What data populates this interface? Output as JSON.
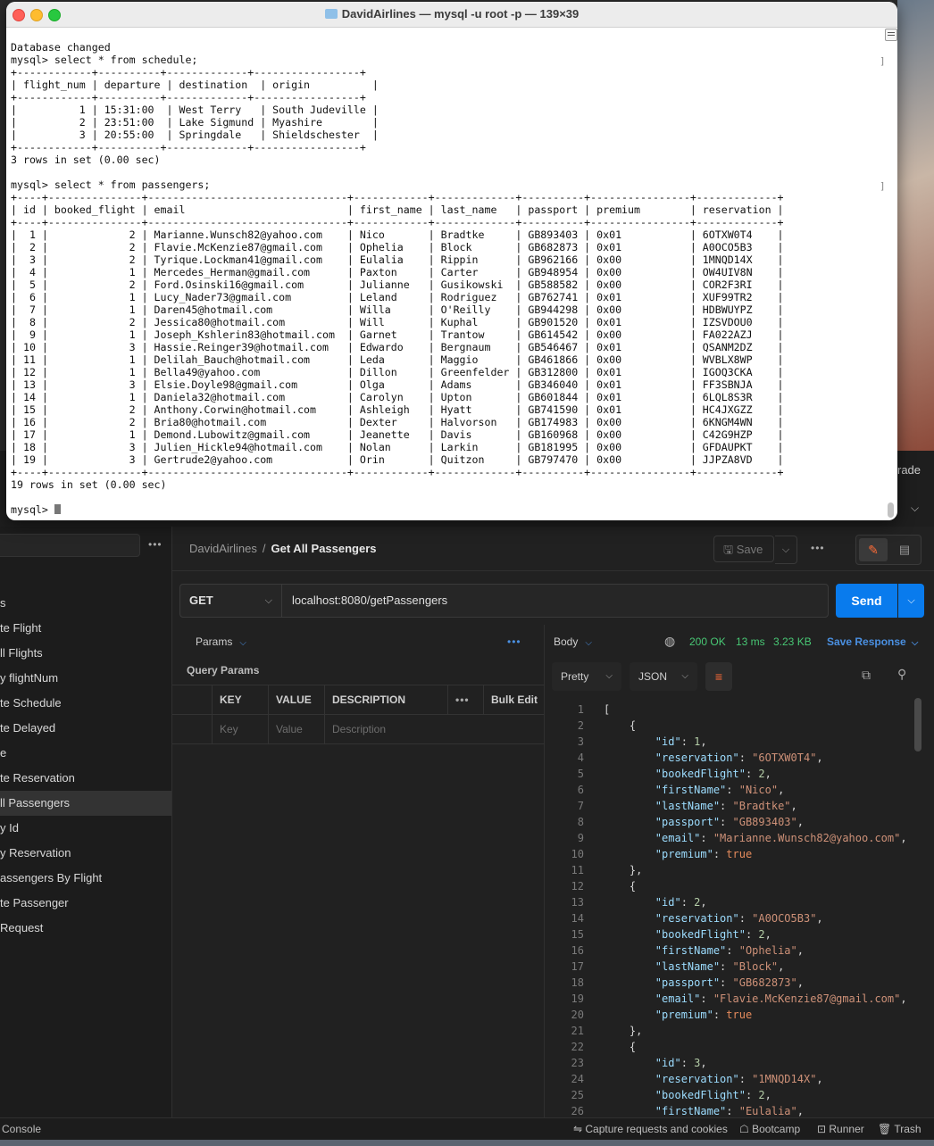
{
  "terminal": {
    "title": "DavidAirlines — mysql -u root -p — 139×39",
    "lines": [
      "Database changed",
      "mysql> select * from schedule;",
      "+------------+----------+-------------+-----------------+",
      "| flight_num | departure | destination  | origin          |",
      "+------------+----------+-------------+-----------------+",
      "|          1 | 15:31:00  | West Terry   | South Judeville |",
      "|          2 | 23:51:00  | Lake Sigmund | Myashire        |",
      "|          3 | 20:55:00  | Springdale   | Shieldschester  |",
      "+------------+----------+-------------+-----------------+",
      "3 rows in set (0.00 sec)",
      "",
      "mysql> select * from passengers;",
      "+----+---------------+--------------------------------+------------+-------------+----------+----------------+-------------+",
      "| id | booked_flight | email                          | first_name | last_name   | passport | premium        | reservation |",
      "+----+---------------+--------------------------------+------------+-------------+----------+----------------+-------------+",
      "|  1 |             2 | Marianne.Wunsch82@yahoo.com    | Nico       | Bradtke     | GB893403 | 0x01           | 6OTXW0T4    |",
      "|  2 |             2 | Flavie.McKenzie87@gmail.com    | Ophelia    | Block       | GB682873 | 0x01           | A0OCO5B3    |",
      "|  3 |             2 | Tyrique.Lockman41@gmail.com    | Eulalia    | Rippin      | GB962166 | 0x00           | 1MNQD14X    |",
      "|  4 |             1 | Mercedes_Herman@gmail.com      | Paxton     | Carter      | GB948954 | 0x00           | OW4UIV8N    |",
      "|  5 |             2 | Ford.Osinski16@gmail.com       | Julianne   | Gusikowski  | GB588582 | 0x00           | COR2F3RI    |",
      "|  6 |             1 | Lucy_Nader73@gmail.com         | Leland     | Rodriguez   | GB762741 | 0x01           | XUF99TR2    |",
      "|  7 |             1 | Daren45@hotmail.com            | Willa      | O'Reilly    | GB944298 | 0x00           | HDBWUYPZ    |",
      "|  8 |             2 | Jessica80@hotmail.com          | Will       | Kuphal      | GB901520 | 0x01           | IZSVDOU0    |",
      "|  9 |             1 | Joseph_Kshlerin83@hotmail.com  | Garnet     | Trantow     | GB614542 | 0x00           | FA022AZJ    |",
      "| 10 |             3 | Hassie.Reinger39@hotmail.com   | Edwardo    | Bergnaum    | GB546467 | 0x01           | QSANM2DZ    |",
      "| 11 |             1 | Delilah_Bauch@hotmail.com      | Leda       | Maggio      | GB461866 | 0x00           | WVBLX8WP    |",
      "| 12 |             1 | Bella49@yahoo.com              | Dillon     | Greenfelder | GB312800 | 0x01           | IGOQ3CKA    |",
      "| 13 |             3 | Elsie.Doyle98@gmail.com        | Olga       | Adams       | GB346040 | 0x01           | FF3SBNJA    |",
      "| 14 |             1 | Daniela32@hotmail.com          | Carolyn    | Upton       | GB601844 | 0x01           | 6LQL8S3R    |",
      "| 15 |             2 | Anthony.Corwin@hotmail.com     | Ashleigh   | Hyatt       | GB741590 | 0x01           | HC4JXGZZ    |",
      "| 16 |             2 | Bria80@hotmail.com             | Dexter     | Halvorson   | GB174983 | 0x00           | 6KNGM4WN    |",
      "| 17 |             1 | Demond.Lubowitz@gmail.com      | Jeanette   | Davis       | GB160968 | 0x00           | C42G9HZP    |",
      "| 18 |             3 | Julien_Hickle94@hotmail.com    | Nolan      | Larkin      | GB181995 | 0x00           | GFDAUPKT    |",
      "| 19 |             3 | Gertrude2@yahoo.com            | Orin       | Quitzon     | GB797470 | 0x00           | JJPZA8VD    |",
      "+----+---------------+--------------------------------+------------+-------------+----------+----------------+-------------+",
      "19 rows in set (0.00 sec)",
      ""
    ],
    "prompt": "mysql> ",
    "right_mark": "]"
  },
  "postman": {
    "upgrade": "rade",
    "sidebar_items": [
      "s",
      "te Flight",
      "ll Flights",
      "y flightNum",
      "te Schedule",
      "te Delayed",
      "e",
      "te Reservation",
      "ll Passengers",
      "y Id",
      "y Reservation",
      "assengers By Flight",
      "te Passenger",
      "Request"
    ],
    "sidebar_active": 8,
    "breadcrumb": {
      "collection": "DavidAirlines",
      "sep": "/",
      "request": "Get All Passengers"
    },
    "save": "Save",
    "method": "GET",
    "url": "localhost:8080/getPassengers",
    "send": "Send",
    "params_tab": "Params",
    "query_params_title": "Query Params",
    "qp_headers": {
      "key": "KEY",
      "value": "VALUE",
      "description": "DESCRIPTION",
      "bulk_edit": "Bulk Edit"
    },
    "qp_placeholders": {
      "key": "Key",
      "value": "Value",
      "description": "Description"
    },
    "response": {
      "body_tab": "Body",
      "status": "200 OK",
      "time": "13 ms",
      "size": "3.23 KB",
      "save_response": "Save Response",
      "format": "Pretty",
      "language": "JSON"
    },
    "code_lines": [
      "[",
      "    {",
      "        \"id\": 1,",
      "        \"reservation\": \"6OTXW0T4\",",
      "        \"bookedFlight\": 2,",
      "        \"firstName\": \"Nico\",",
      "        \"lastName\": \"Bradtke\",",
      "        \"passport\": \"GB893403\",",
      "        \"email\": \"Marianne.Wunsch82@yahoo.com\",",
      "        \"premium\": true",
      "    },",
      "    {",
      "        \"id\": 2,",
      "        \"reservation\": \"A0OCO5B3\",",
      "        \"bookedFlight\": 2,",
      "        \"firstName\": \"Ophelia\",",
      "        \"lastName\": \"Block\",",
      "        \"passport\": \"GB682873\",",
      "        \"email\": \"Flavie.McKenzie87@gmail.com\",",
      "        \"premium\": true",
      "    },",
      "    {",
      "        \"id\": 3,",
      "        \"reservation\": \"1MNQD14X\",",
      "        \"bookedFlight\": 2,",
      "        \"firstName\": \"Eulalia\","
    ],
    "footer": {
      "console": "Console",
      "capture": "Capture requests and cookies",
      "bootcamp": "Bootcamp",
      "runner": "Runner",
      "trash": "Trash"
    }
  },
  "colors": {
    "send_button": "#097bed",
    "status_ok": "#48c774",
    "accent_orange": "#ff6c37",
    "link_blue": "#4a90e2"
  },
  "icons": [
    "folder-icon",
    "chevron-down-icon",
    "save-icon",
    "more-icon",
    "edit-icon",
    "comment-icon",
    "globe-icon",
    "wrap-icon",
    "copy-icon",
    "search-icon",
    "cookie-icon",
    "bootcamp-icon",
    "runner-icon",
    "trash-icon"
  ]
}
